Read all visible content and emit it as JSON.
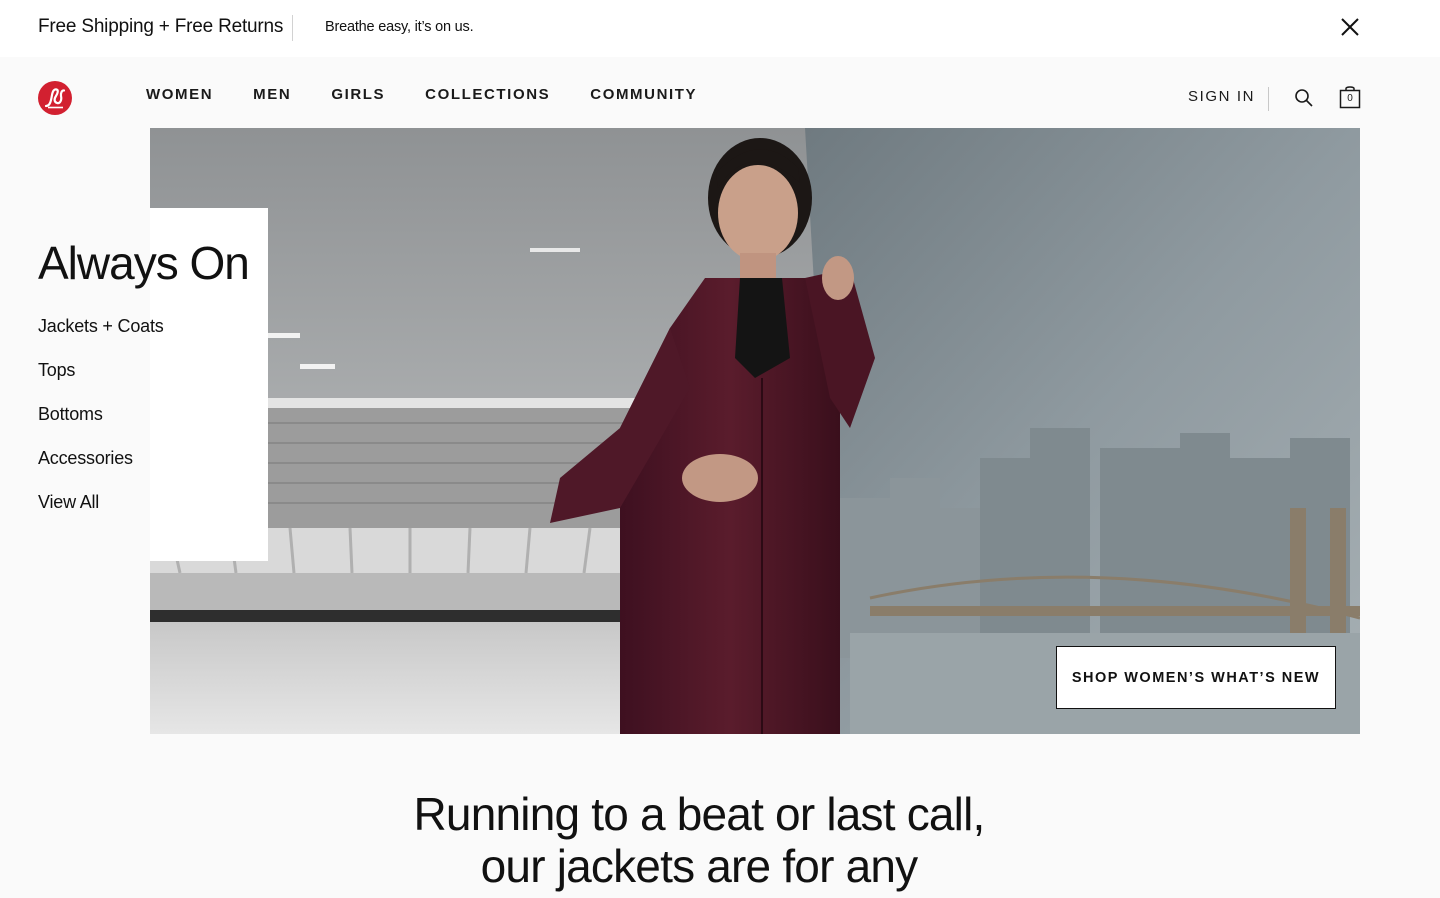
{
  "promo": {
    "title": "Free Shipping + Free Returns",
    "subtitle": "Breathe easy, it’s on us.",
    "close_icon": "close-icon"
  },
  "header": {
    "logo_icon": "lululemon-logo-icon",
    "nav": [
      {
        "label": "WOMEN"
      },
      {
        "label": "MEN"
      },
      {
        "label": "GIRLS"
      },
      {
        "label": "COLLECTIONS"
      },
      {
        "label": "COMMUNITY"
      }
    ],
    "sign_in": "SIGN IN",
    "search_icon": "search-icon",
    "bag_icon": "shopping-bag-icon",
    "bag_count": "0"
  },
  "colors": {
    "brand_red": "#d22030",
    "jacket": "#4a1622",
    "background": "#fafafa"
  },
  "hero": {
    "panel_title": "Always On",
    "categories": [
      {
        "label": "Jackets + Coats"
      },
      {
        "label": "Tops"
      },
      {
        "label": "Bottoms"
      },
      {
        "label": "Accessories"
      },
      {
        "label": "View All"
      }
    ],
    "cta": "SHOP WOMEN’S WHAT’S NEW"
  },
  "tagline": {
    "line1": "Running to a beat or last call,",
    "line2": "our jackets are for any"
  }
}
